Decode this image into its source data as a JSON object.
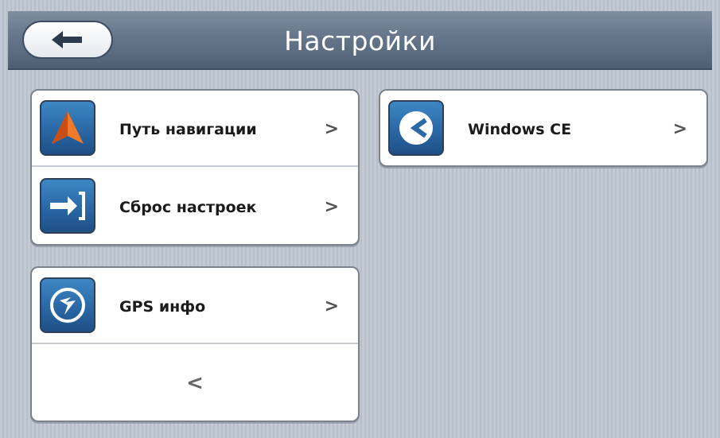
{
  "header": {
    "title": "Настройки",
    "back_icon": "back-arrow-icon"
  },
  "left_group_1": {
    "items": [
      {
        "label": "Путь навигации",
        "icon": "navigation-arrow-icon",
        "chevron": ">"
      },
      {
        "label": "Сброс настроек",
        "icon": "reset-icon",
        "chevron": ">"
      }
    ]
  },
  "left_group_2": {
    "items": [
      {
        "label": "GPS инфо",
        "icon": "gps-satellite-icon",
        "chevron": ">"
      }
    ],
    "prev_chevron": "<"
  },
  "right_group": {
    "items": [
      {
        "label": "Windows CE",
        "icon": "windows-ce-icon",
        "chevron": ">"
      }
    ]
  },
  "colors": {
    "header": "#66768a",
    "accent_orange": "#e8641c",
    "icon_blue": "#2b6aa8"
  }
}
